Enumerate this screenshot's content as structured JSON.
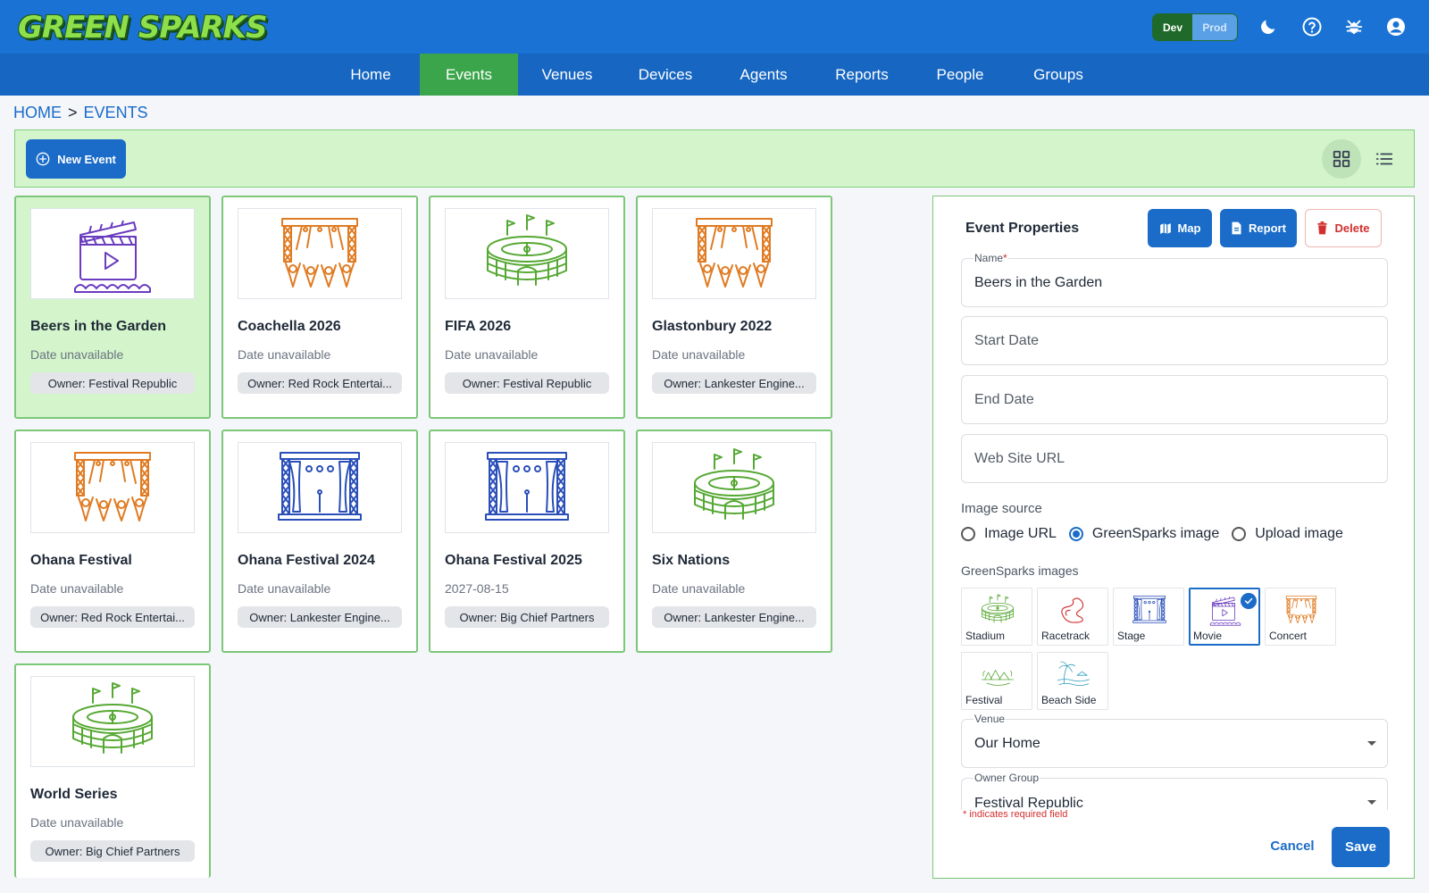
{
  "app": {
    "logo_text": "GREEN SPARKS"
  },
  "env": {
    "dev_label": "Dev",
    "prod_label": "Prod",
    "active": "Dev"
  },
  "top_icons": [
    "moon-icon",
    "help-icon",
    "bug-icon",
    "account-icon"
  ],
  "nav": {
    "items": [
      {
        "label": "Home"
      },
      {
        "label": "Events",
        "active": true
      },
      {
        "label": "Venues"
      },
      {
        "label": "Devices"
      },
      {
        "label": "Agents"
      },
      {
        "label": "Reports"
      },
      {
        "label": "People"
      },
      {
        "label": "Groups"
      }
    ]
  },
  "breadcrumb": {
    "home": "HOME",
    "separator": ">",
    "current": "EVENTS"
  },
  "toolbar": {
    "new_event_label": "New Event",
    "view_mode": "grid"
  },
  "events": [
    {
      "title": "Beers in the Garden",
      "date": "Date unavailable",
      "owner": "Owner: Festival Republic",
      "image": "movie",
      "selected": true
    },
    {
      "title": "Coachella 2026",
      "date": "Date unavailable",
      "owner": "Owner: Red Rock Entertai...",
      "image": "concert"
    },
    {
      "title": "FIFA 2026",
      "date": "Date unavailable",
      "owner": "Owner: Festival Republic",
      "image": "stadium"
    },
    {
      "title": "Glastonbury 2022",
      "date": "Date unavailable",
      "owner": "Owner: Lankester Engine...",
      "image": "concert"
    },
    {
      "title": "Ohana Festival",
      "date": "Date unavailable",
      "owner": "Owner: Red Rock Entertai...",
      "image": "concert"
    },
    {
      "title": "Ohana Festival 2024",
      "date": "Date unavailable",
      "owner": "Owner: Lankester Engine...",
      "image": "stage"
    },
    {
      "title": "Ohana Festival 2025",
      "date": "2027-08-15",
      "owner": "Owner: Big Chief Partners",
      "image": "stage"
    },
    {
      "title": "Six Nations",
      "date": "Date unavailable",
      "owner": "Owner: Lankester Engine...",
      "image": "stadium"
    },
    {
      "title": "World Series",
      "date": "Date unavailable",
      "owner": "Owner: Big Chief Partners",
      "image": "stadium"
    }
  ],
  "properties": {
    "title": "Event Properties",
    "map_label": "Map",
    "report_label": "Report",
    "delete_label": "Delete",
    "name_label": "Name",
    "name_required_mark": "*",
    "name_value": "Beers in the Garden",
    "start_date_placeholder": "Start Date",
    "end_date_placeholder": "End Date",
    "website_placeholder": "Web Site URL",
    "image_source_label": "Image source",
    "image_source_options": [
      "Image URL",
      "GreenSparks image",
      "Upload image"
    ],
    "image_source_selected": "GreenSparks image",
    "gs_images_label": "GreenSparks images",
    "gs_images": [
      {
        "name": "Stadium",
        "icon": "stadium"
      },
      {
        "name": "Racetrack",
        "icon": "racetrack"
      },
      {
        "name": "Stage",
        "icon": "stage"
      },
      {
        "name": "Movie",
        "icon": "movie",
        "selected": true
      },
      {
        "name": "Concert",
        "icon": "concert"
      },
      {
        "name": "Festival",
        "icon": "festival"
      },
      {
        "name": "Beach Side",
        "icon": "beach"
      }
    ],
    "venue_label": "Venue",
    "venue_value": "Our Home",
    "owner_group_label": "Owner Group",
    "owner_group_value": "Festival Republic",
    "required_note": "* indicates required field",
    "cancel_label": "Cancel",
    "save_label": "Save"
  },
  "colors": {
    "header_blue": "#1a73d4",
    "nav_blue": "#1666c2",
    "active_green": "#3aa54a",
    "accent_blue": "#1a6cc8",
    "selected_card_bg": "#d4f5cc",
    "danger_red": "#d32f2f"
  }
}
